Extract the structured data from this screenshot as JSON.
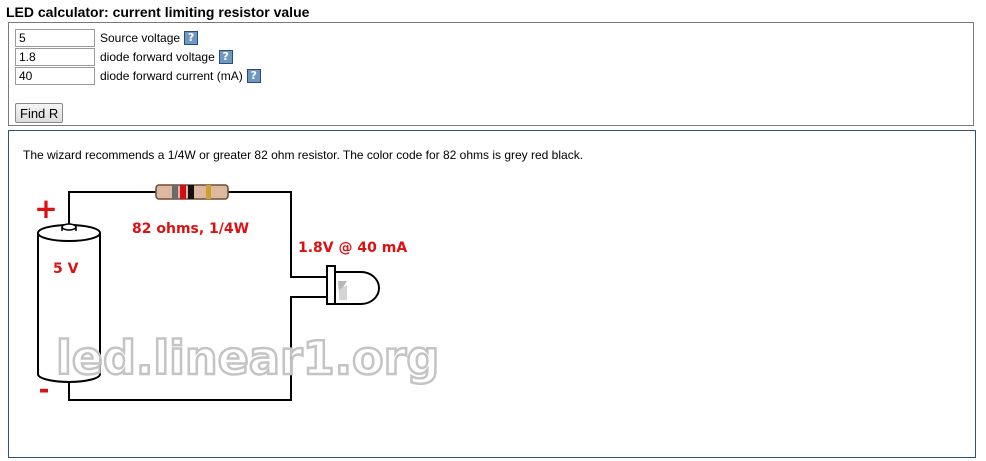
{
  "page_title": "LED calculator: current limiting resistor value",
  "form": {
    "fields": [
      {
        "value": "5",
        "label": "Source voltage"
      },
      {
        "value": "1.8",
        "label": "diode forward voltage"
      },
      {
        "value": "40",
        "label": "diode forward current (mA)"
      }
    ],
    "help_icon": "?",
    "submit_label": "Find R"
  },
  "result": {
    "text": "The wizard recommends a 1/4W or greater 82 ohm resistor. The color code for 82 ohms is grey red black."
  },
  "diagram": {
    "plus_sign": "+",
    "minus_sign": "-",
    "battery_label": "5 V",
    "resistor_label": "82 ohms, 1/4W",
    "led_label": "1.8V @ 40 mA",
    "watermark": "led.linear1.org",
    "resistor_bands": [
      "#6b6b6b",
      "#d01010",
      "#111111",
      "#c9a227"
    ],
    "label_color": "#dd1111"
  }
}
